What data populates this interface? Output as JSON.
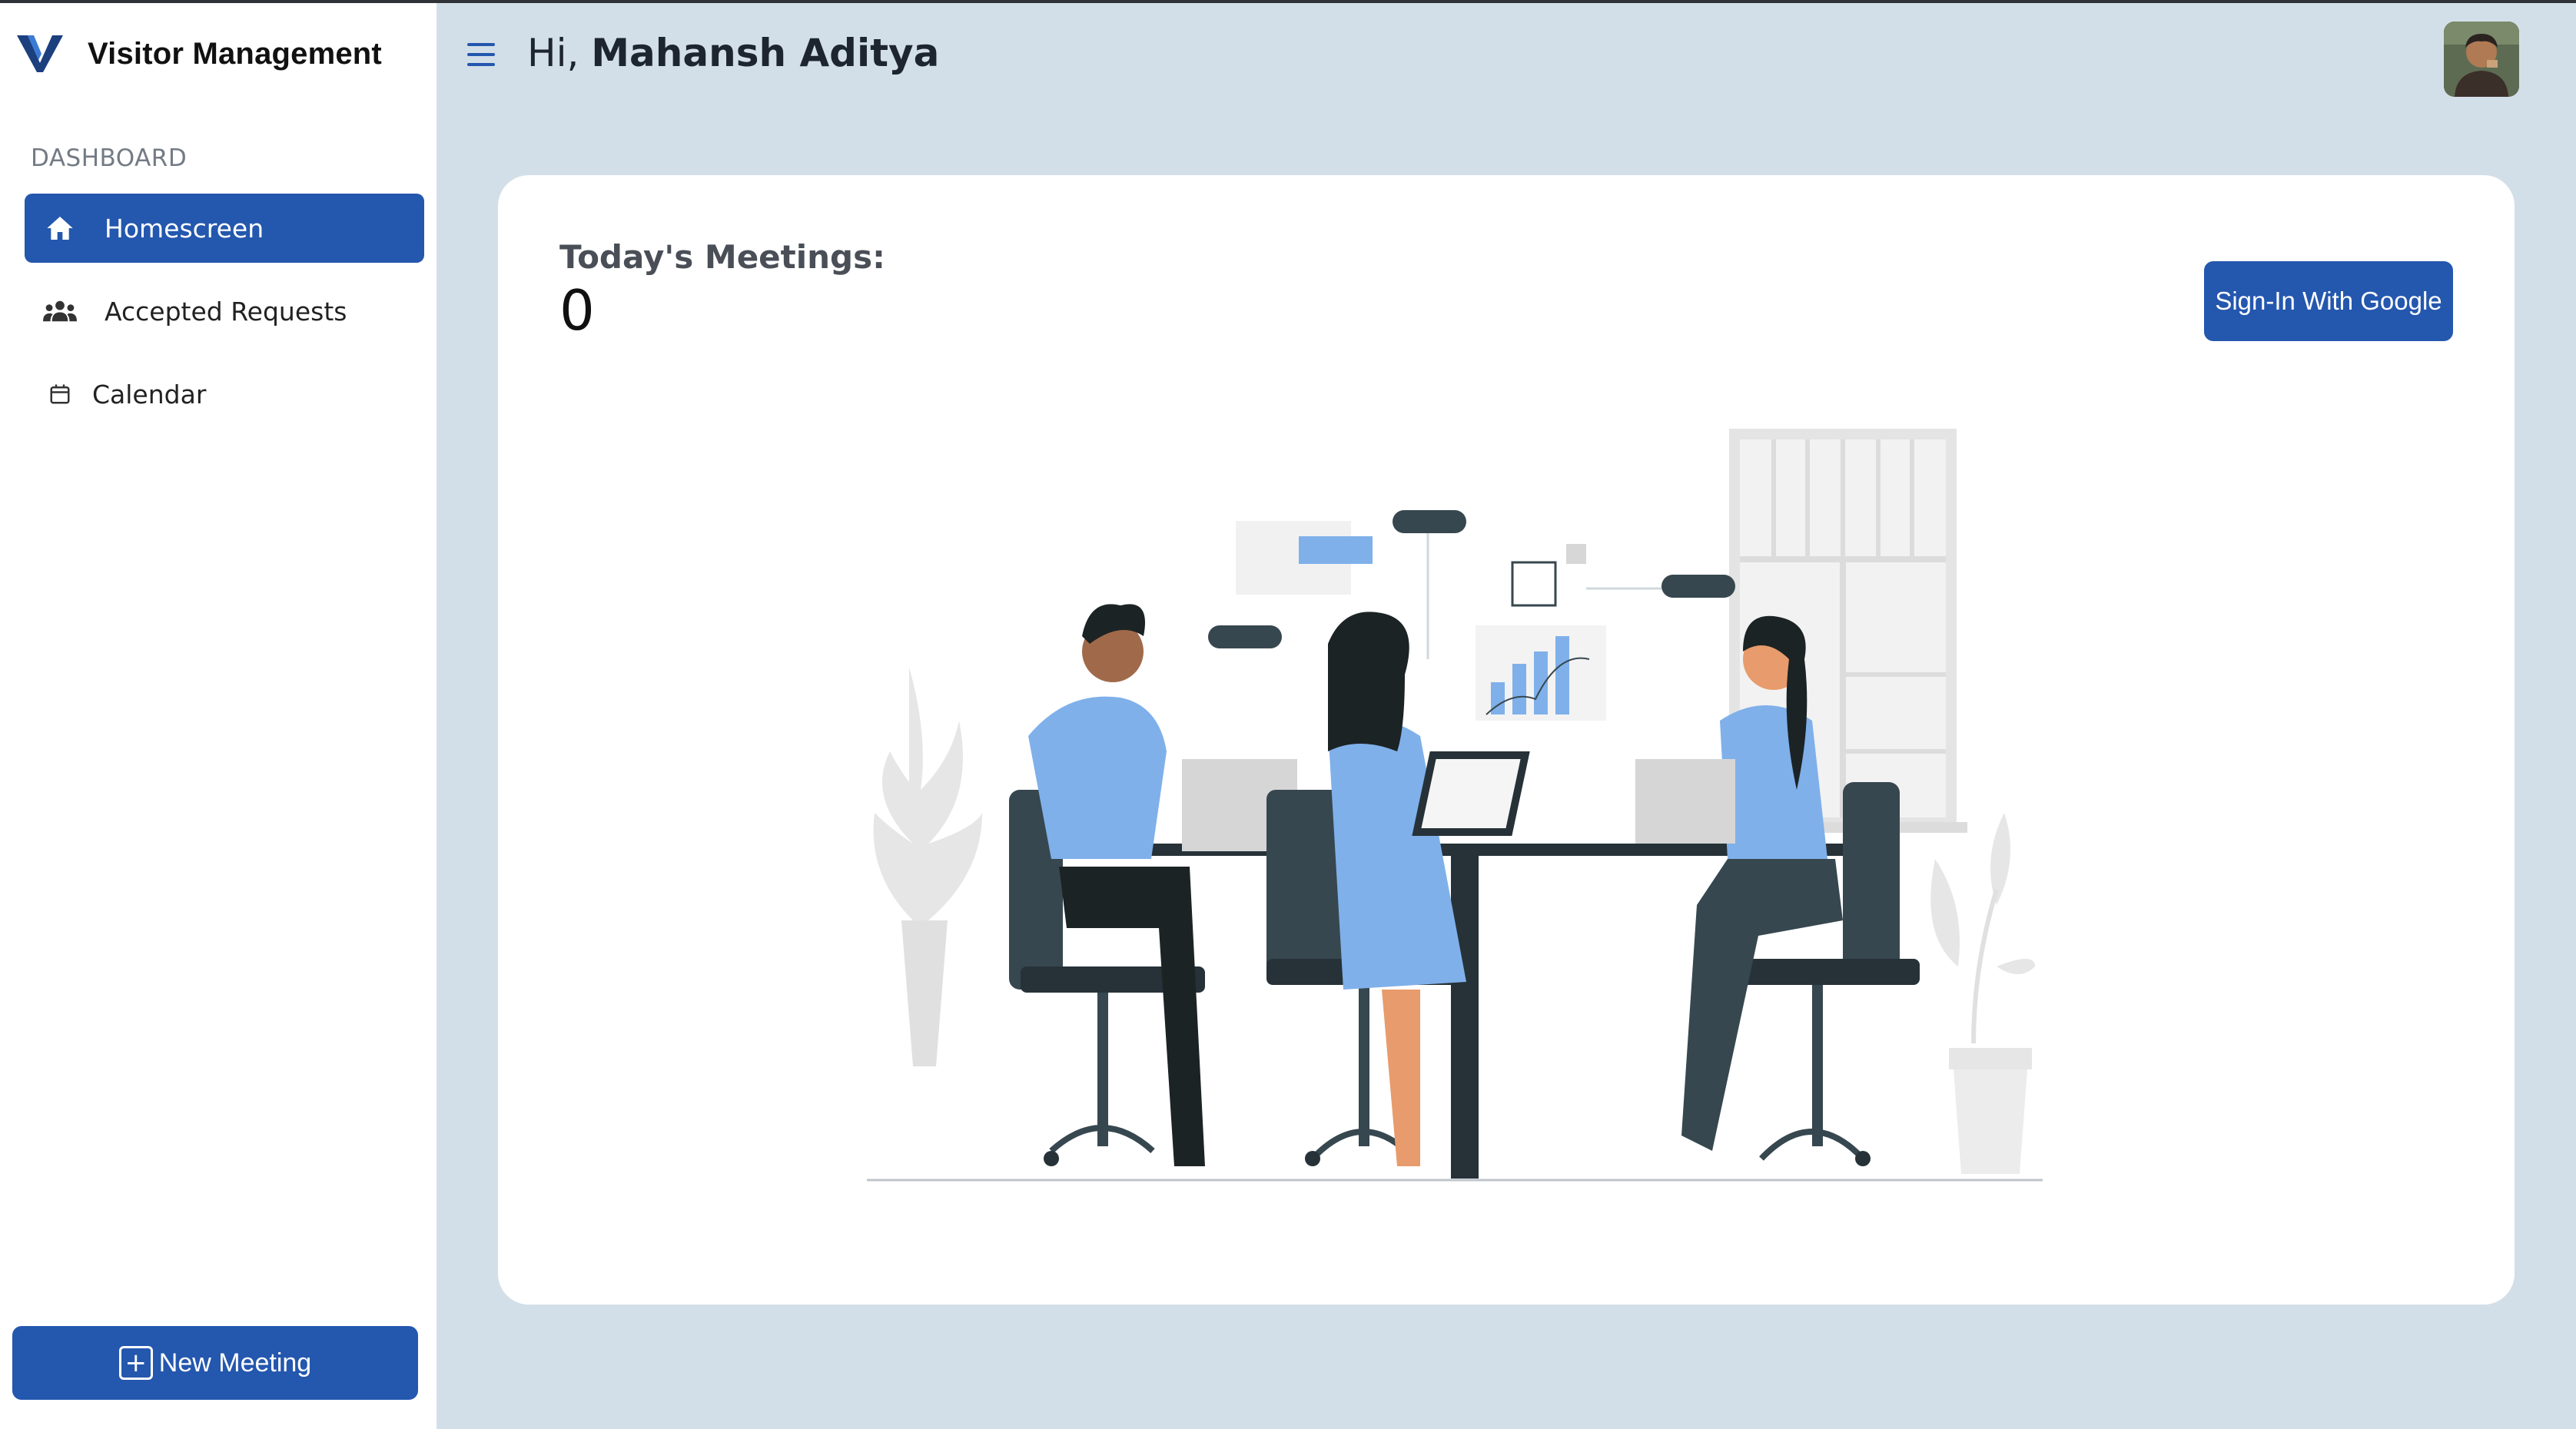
{
  "app": {
    "brand_name": "Visitor Management"
  },
  "colors": {
    "primary": "#2457ae",
    "background": "#d3dfe8",
    "card": "#ffffff"
  },
  "sidebar": {
    "section_label": "DASHBOARD",
    "items": [
      {
        "label": "Homescreen",
        "icon": "home-icon",
        "active": true
      },
      {
        "label": "Accepted Requests",
        "icon": "people-icon",
        "active": false
      },
      {
        "label": "Calendar",
        "icon": "calendar-icon",
        "active": false
      }
    ],
    "new_meeting_label": "New Meeting"
  },
  "header": {
    "greeting_prefix": "Hi,",
    "user_name": "Mahansh Aditya"
  },
  "main": {
    "meetings_label": "Today's Meetings:",
    "meetings_count": "0",
    "google_button_label": "Sign-In With Google"
  }
}
